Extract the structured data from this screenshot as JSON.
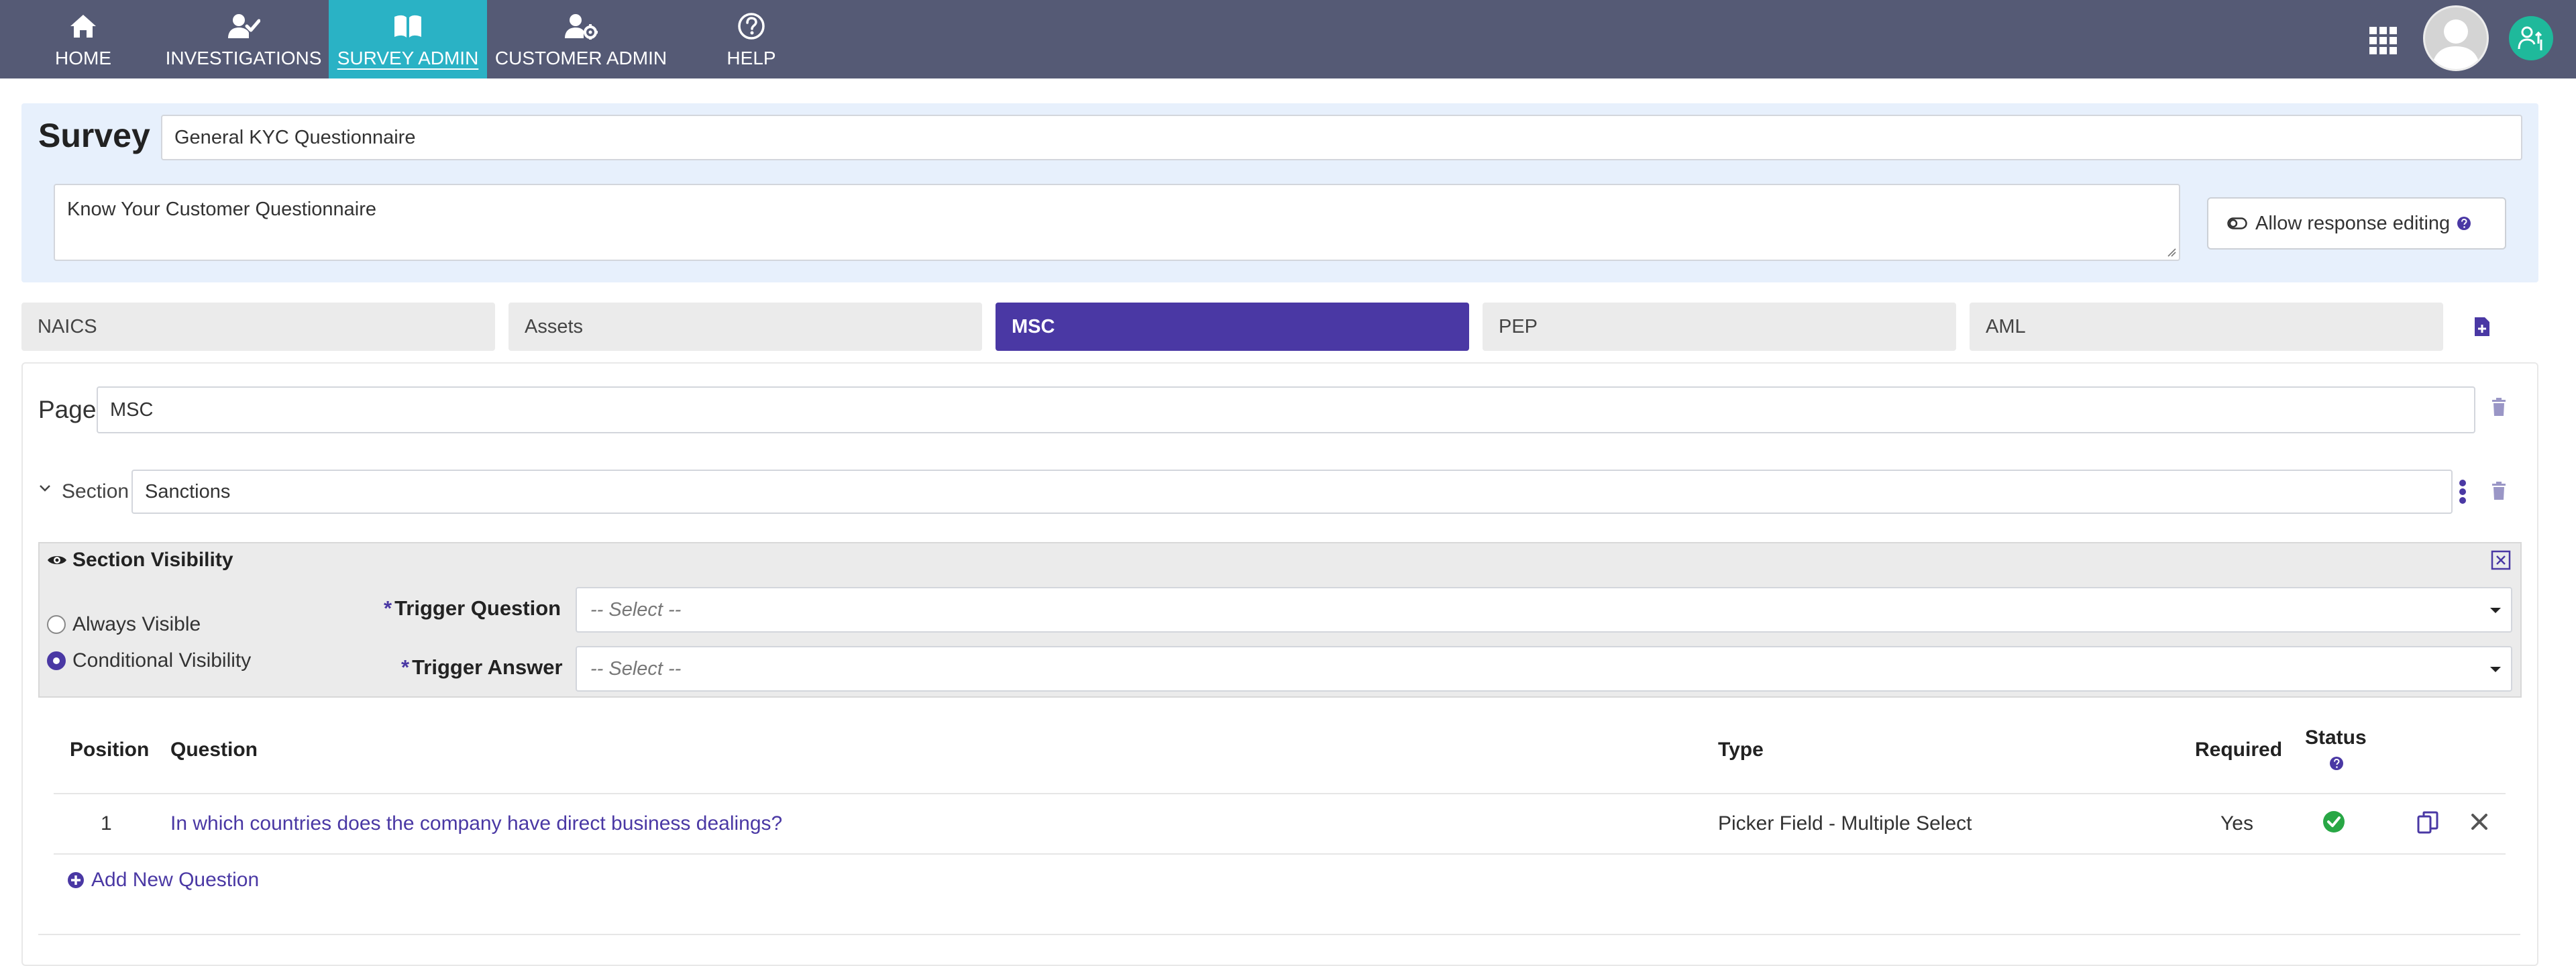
{
  "nav": {
    "items": [
      {
        "label": "HOME",
        "icon": "home-icon"
      },
      {
        "label": "INVESTIGATIONS",
        "icon": "user-check-icon"
      },
      {
        "label": "SURVEY ADMIN",
        "icon": "book-open-icon",
        "active": true
      },
      {
        "label": "CUSTOMER ADMIN",
        "icon": "user-gear-icon"
      },
      {
        "label": "HELP",
        "icon": "question-circle-icon"
      }
    ],
    "right_icons": [
      "apps-grid-icon",
      "avatar",
      "user-switch-icon"
    ]
  },
  "survey": {
    "label": "Survey",
    "name": "General KYC Questionnaire",
    "description": "Know Your Customer Questionnaire",
    "allow_editing_label": "Allow response editing"
  },
  "tabs": [
    {
      "label": "NAICS"
    },
    {
      "label": "Assets"
    },
    {
      "label": "MSC",
      "active": true
    },
    {
      "label": "PEP"
    },
    {
      "label": "AML"
    }
  ],
  "page": {
    "label": "Page",
    "name": "MSC",
    "section": {
      "label": "Section",
      "name": "Sanctions",
      "visibility": {
        "title": "Section Visibility",
        "options": [
          "Always Visible",
          "Conditional Visibility"
        ],
        "selected": "Conditional Visibility",
        "trigger_question": {
          "label": "Trigger Question",
          "placeholder": "-- Select --"
        },
        "trigger_answer": {
          "label": "Trigger Answer",
          "placeholder": "-- Select --"
        }
      }
    }
  },
  "table": {
    "headers": {
      "position": "Position",
      "question": "Question",
      "type": "Type",
      "required": "Required",
      "status": "Status"
    },
    "rows": [
      {
        "position": "1",
        "question": "In which countries does the company have direct business dealings?",
        "type": "Picker Field - Multiple Select",
        "required": "Yes",
        "status": "valid"
      }
    ],
    "add_label": "Add New Question"
  },
  "colors": {
    "nav_bg": "#555a75",
    "nav_active": "#2ab2c5",
    "accent": "#4a38a4",
    "status_ok": "#28a745"
  }
}
